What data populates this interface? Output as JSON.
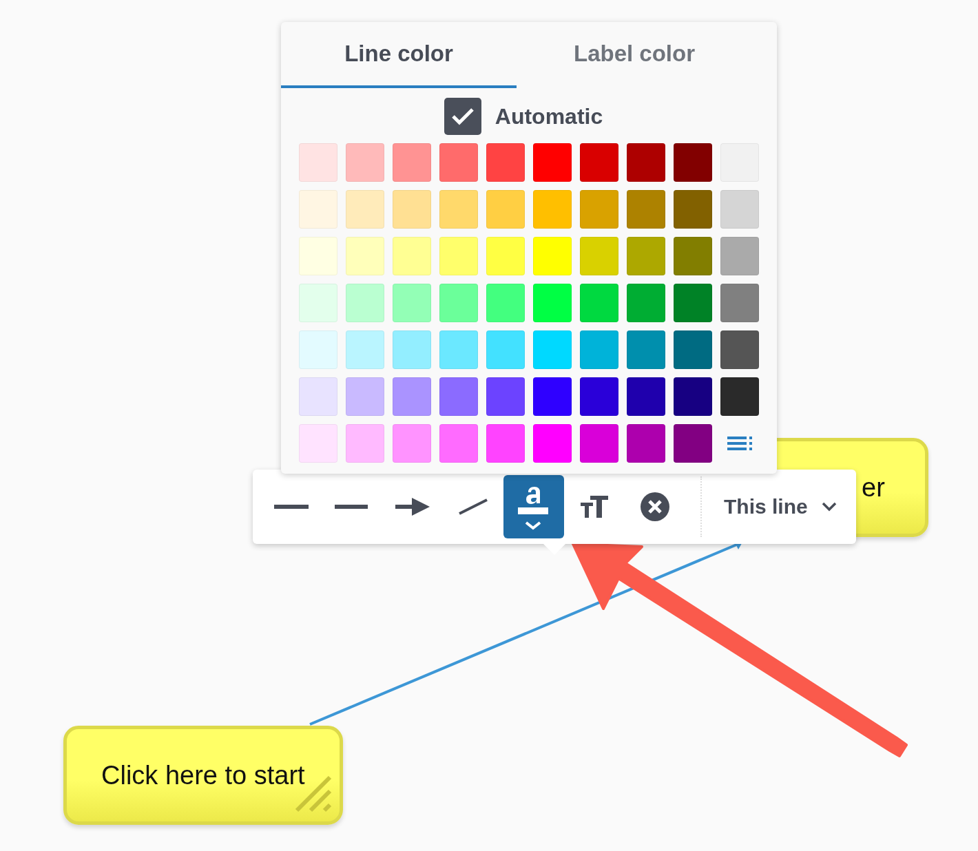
{
  "color_popup": {
    "tabs": [
      {
        "label": "Line color",
        "selected": true
      },
      {
        "label": "Label color",
        "selected": false
      }
    ],
    "automatic": {
      "label": "Automatic",
      "checked": true
    },
    "rows": [
      {
        "swatches": [
          {
            "color": "#ffe3e3"
          },
          {
            "color": "#ffbaba"
          },
          {
            "color": "#ff9393"
          },
          {
            "color": "#ff6b6b"
          },
          {
            "color": "#ff4343"
          },
          {
            "color": "#ff0000"
          },
          {
            "color": "#d90000"
          },
          {
            "color": "#ad0000"
          },
          {
            "color": "#820000"
          },
          {
            "color": "#f1f1f1"
          }
        ]
      },
      {
        "swatches": [
          {
            "color": "#fff6e3"
          },
          {
            "color": "#ffebba"
          },
          {
            "color": "#ffe093"
          },
          {
            "color": "#ffd96b"
          },
          {
            "color": "#ffcf43"
          },
          {
            "color": "#ffbf00"
          },
          {
            "color": "#d9a200"
          },
          {
            "color": "#ad8200"
          },
          {
            "color": "#826100"
          },
          {
            "color": "#d5d5d5"
          }
        ]
      },
      {
        "swatches": [
          {
            "color": "#ffffe3"
          },
          {
            "color": "#ffffba"
          },
          {
            "color": "#ffff93"
          },
          {
            "color": "#ffff6b"
          },
          {
            "color": "#ffff43"
          },
          {
            "color": "#ffff00"
          },
          {
            "color": "#d9d100"
          },
          {
            "color": "#ada800"
          },
          {
            "color": "#827e00"
          },
          {
            "color": "#aaaaaa"
          }
        ]
      },
      {
        "swatches": [
          {
            "color": "#e3ffec"
          },
          {
            "color": "#baffd1"
          },
          {
            "color": "#93ffb6"
          },
          {
            "color": "#6bff9a"
          },
          {
            "color": "#43ff7f"
          },
          {
            "color": "#00ff44"
          },
          {
            "color": "#00d940"
          },
          {
            "color": "#00ad33"
          },
          {
            "color": "#008226"
          },
          {
            "color": "#808080"
          }
        ]
      },
      {
        "swatches": [
          {
            "color": "#e3fbff"
          },
          {
            "color": "#baf5ff"
          },
          {
            "color": "#93eeff"
          },
          {
            "color": "#6be8ff"
          },
          {
            "color": "#43e1ff"
          },
          {
            "color": "#00d9ff"
          },
          {
            "color": "#00b3d9"
          },
          {
            "color": "#008fad"
          },
          {
            "color": "#006b82"
          },
          {
            "color": "#555555"
          }
        ]
      },
      {
        "swatches": [
          {
            "color": "#e8e3ff"
          },
          {
            "color": "#c9baff"
          },
          {
            "color": "#aa93ff"
          },
          {
            "color": "#8b6bff"
          },
          {
            "color": "#6c43ff"
          },
          {
            "color": "#2f00ff"
          },
          {
            "color": "#2a00d9"
          },
          {
            "color": "#1f00ad"
          },
          {
            "color": "#170082"
          },
          {
            "color": "#2a2a2a"
          }
        ]
      },
      {
        "swatches": [
          {
            "color": "#ffe3ff"
          },
          {
            "color": "#ffbaff"
          },
          {
            "color": "#ff93ff"
          },
          {
            "color": "#ff6bff"
          },
          {
            "color": "#ff43ff"
          },
          {
            "color": "#ff00ff"
          },
          {
            "color": "#d900d9"
          },
          {
            "color": "#ad00ad"
          },
          {
            "color": "#820082"
          }
        ]
      }
    ]
  },
  "toolbar": {
    "tools": [
      {
        "kind": "solid",
        "selected": false
      },
      {
        "kind": "dashed",
        "selected": false
      },
      {
        "kind": "arrow",
        "selected": false
      },
      {
        "kind": "slant",
        "selected": false
      },
      {
        "kind": "label",
        "selected": true
      },
      {
        "kind": "textsize",
        "selected": false
      },
      {
        "kind": "delete",
        "selected": false
      }
    ],
    "scope": {
      "label": "This line"
    }
  },
  "notes": [
    {
      "kind": "start",
      "text": "Click here to start"
    },
    {
      "kind": "other",
      "text": "er"
    }
  ]
}
